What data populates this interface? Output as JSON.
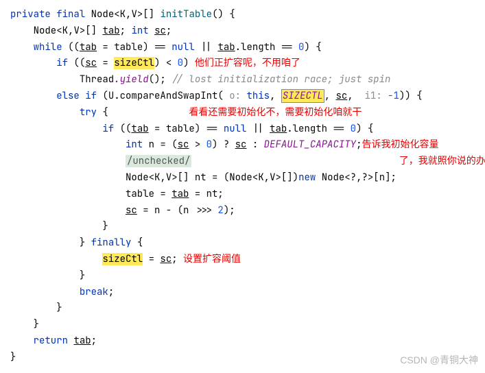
{
  "l1": {
    "private": "private",
    "final": "final",
    "node": "Node",
    "g1": "<",
    "k": "K",
    "c": ",",
    "v": "V",
    "g2": ">[] ",
    "fn": "initTable",
    "paren": "() {"
  },
  "l2": {
    "node": "Node",
    "g1": "<",
    "k": "K",
    "c": ",",
    "v": "V",
    "g2": ">[] ",
    "tab": "tab",
    "semi": "; ",
    "int": "int",
    "sp": " ",
    "sc": "sc",
    "end": ";"
  },
  "l3": {
    "while": "while",
    "p1": " ((",
    "tab": "tab",
    "eq": " = ",
    "table": "table",
    "p2": ") == ",
    "null": "null",
    "or": " || ",
    "tab2": "tab",
    "len": ".length == ",
    "zero": "0",
    "end": ") {"
  },
  "l4": {
    "if": "if",
    "p1": " ((",
    "sc": "sc",
    "eq": " = ",
    "size": "sizeCtl",
    "p2": ") < ",
    "zero": "0",
    "end": ") ",
    "note": "他们正扩容呢，不用咱了"
  },
  "l5": {
    "thread": "Thread",
    "yield": ".yield",
    "paren": "(); ",
    "comment": "// lost initialization race; just spin"
  },
  "l6": {
    "else": "else if",
    "p1": " (",
    "u": "U",
    "call": ".compareAndSwapInt(",
    "pn1": " o: ",
    "this": "this",
    "c1": ", ",
    "size": "SIZECTL",
    "c2": ", ",
    "sc": "sc",
    "c3": ", ",
    "pn2": " i1: ",
    "neg1": "-1",
    "end": ")) {"
  },
  "l7": {
    "try": "try",
    "brace": " {",
    "pad": "              ",
    "note": "看看还需要初始化不，需要初始化咱就干"
  },
  "l8": {
    "if": "if",
    "p1": " ((",
    "tab": "tab",
    "eq": " = ",
    "table": "table",
    "p2": ") == ",
    "null": "null",
    "or": " || ",
    "tab2": "tab",
    "len": ".length == ",
    "zero": "0",
    "end": ") {"
  },
  "l9": {
    "int": "int",
    "n": " n = (",
    "sc": "sc",
    "gt": " > ",
    "zero": "0",
    "q": ") ? ",
    "sc2": "sc",
    "col": " : ",
    "cap": "DEFAULT_CAPACITY",
    "semi": ";",
    "note": "告诉我初始化容量"
  },
  "l10": {
    "box": "/unchecked/",
    "note": "了，我就照你说的办"
  },
  "l11": {
    "node": "Node",
    "g1": "<",
    "k": "K",
    "c1": ",",
    "v": "V",
    "g2": ">[] nt = (",
    "node2": "Node",
    "g3": "<",
    "k2": "K",
    "c2": ",",
    "v2": "V",
    "g4": ">[])",
    "new": "new",
    "sp": " ",
    "node3": "Node",
    "g5": "<?,?>[n];"
  },
  "l12": {
    "table": "table",
    "eq": " = ",
    "tab": "tab",
    "eq2": " = nt;"
  },
  "l13": {
    "sc": "sc",
    "eq": " = n - (n >>> ",
    "two": "2",
    "end": ");"
  },
  "l14": {
    "brace": "}"
  },
  "l15": {
    "brace": "} ",
    "finally": "finally",
    "b2": " {"
  },
  "l16": {
    "size": "sizeCtl",
    "eq": " = ",
    "sc": "sc",
    "semi": "; ",
    "note": "设置扩容阈值"
  },
  "l17": {
    "brace": "}"
  },
  "l18": {
    "break": "break",
    "semi": ";"
  },
  "l19": {
    "brace": "}"
  },
  "l20": {
    "brace": "}"
  },
  "l21": {
    "return": "return",
    "sp": " ",
    "tab": "tab",
    "semi": ";"
  },
  "l22": {
    "brace": "}"
  },
  "watermark": "CSDN @青铜大神"
}
